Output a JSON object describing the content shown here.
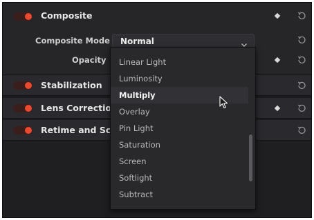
{
  "colors": {
    "panel_bg": "#1c1c1f",
    "header_bg": "#2a2a2e",
    "toggle_on": "#e8492f",
    "text_primary": "#e6e6e6",
    "text_secondary": "#b9b9bd",
    "highlight_bg": "#323236"
  },
  "composite": {
    "title": "Composite",
    "enabled": true,
    "mode_label": "Composite Mode",
    "mode_value": "Normal",
    "opacity_label": "Opacity"
  },
  "dropdown": {
    "items": [
      {
        "label": "Linear Light"
      },
      {
        "label": "Luminosity"
      },
      {
        "label": "Multiply",
        "highlighted": true
      },
      {
        "label": "Overlay"
      },
      {
        "label": "Pin Light"
      },
      {
        "label": "Saturation"
      },
      {
        "label": "Screen"
      },
      {
        "label": "Softlight"
      },
      {
        "label": "Subtract"
      }
    ]
  },
  "sections": {
    "stabilization": {
      "title": "Stabilization",
      "enabled": true
    },
    "lens_correction": {
      "title": "Lens Correction",
      "enabled": true
    },
    "retime": {
      "title": "Retime and Scaling",
      "enabled": true
    }
  },
  "icons": {
    "keyframe": "keyframe-diamond-icon",
    "reset": "reset-icon",
    "dropdown": "chevron-down-icon",
    "pointer": "mouse-pointer-icon"
  }
}
